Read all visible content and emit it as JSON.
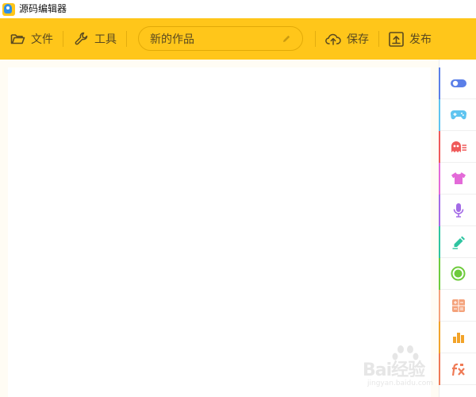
{
  "window": {
    "title": "源码编辑器"
  },
  "toolbar": {
    "file_label": "文件",
    "tools_label": "工具",
    "project_name": "新的作品",
    "save_label": "保存",
    "publish_label": "发布"
  },
  "sidebar": {
    "categories": [
      {
        "icon": "toggle-icon",
        "color": "#5b7fe8"
      },
      {
        "icon": "gamepad-icon",
        "color": "#5fc4f0"
      },
      {
        "icon": "ghost-icon",
        "color": "#ef5a5a"
      },
      {
        "icon": "tshirt-icon",
        "color": "#e36ad8"
      },
      {
        "icon": "microphone-icon",
        "color": "#a36be6"
      },
      {
        "icon": "pen-icon",
        "color": "#2ec4a0"
      },
      {
        "icon": "circle-target-icon",
        "color": "#6ecb3c"
      },
      {
        "icon": "calculator-icon",
        "color": "#f4a27b"
      },
      {
        "icon": "bar-chart-icon",
        "color": "#f2a329"
      },
      {
        "icon": "function-icon",
        "color": "#ef7a55"
      }
    ]
  },
  "watermark": {
    "text": "Bai经验",
    "url": "jingyan.baidu.com"
  },
  "colors": {
    "toolbar": "#ffc61a",
    "workspace": "#fffcf4"
  }
}
